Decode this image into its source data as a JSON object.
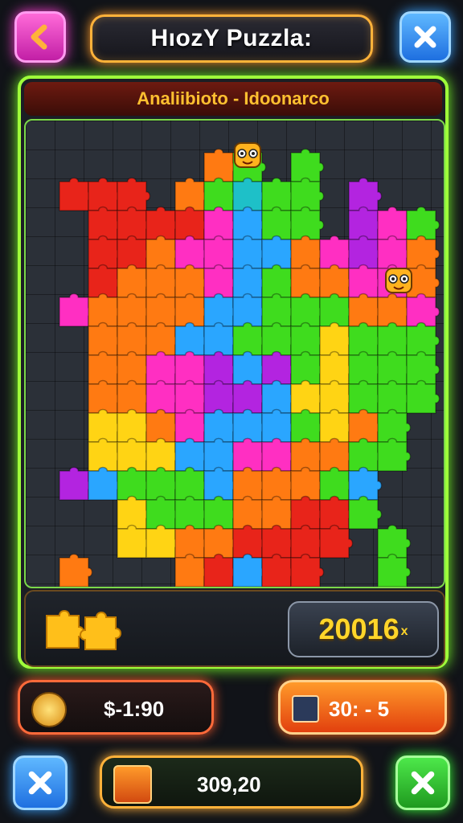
{
  "header": {
    "title": "HıozY Puzzla:",
    "back_icon": "chevron-left-icon",
    "close_icon": "close-icon"
  },
  "board": {
    "subtitle": "Analiibioto - Idoonarco"
  },
  "tray": {
    "score": "20016",
    "score_suffix": "x"
  },
  "stats": {
    "coins": "$-1:90",
    "moves": "30: - 5"
  },
  "footer": {
    "total": "309,20",
    "close_icon": "close-icon",
    "confirm_icon": "checkmark-icon"
  },
  "colors": {
    "accent_green": "#9fff3a",
    "accent_orange": "#ffb23a",
    "score_yellow": "#ffd52a"
  }
}
